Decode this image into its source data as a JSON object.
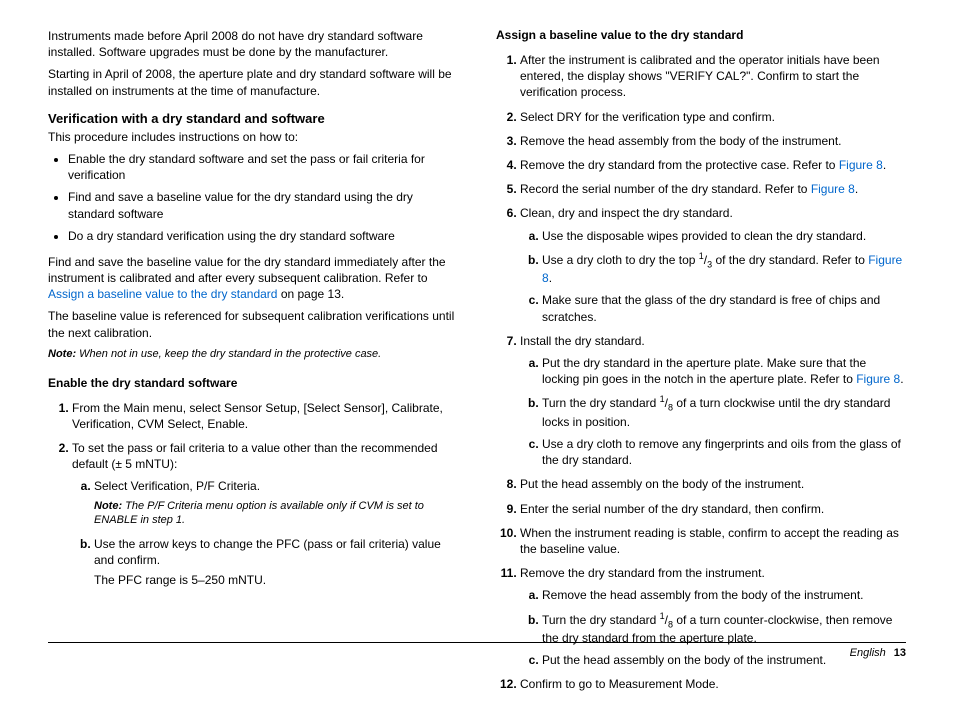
{
  "left": {
    "intro1": "Instruments made before April 2008 do not have dry standard software installed. Software upgrades must be done by the manufacturer.",
    "intro2": "Starting in April of 2008, the aperture plate and dry standard software will be installed on instruments at the time of manufacture.",
    "verif_heading": "Verification with a dry standard and software",
    "verif_intro": "This procedure includes instructions on how to:",
    "bullets": {
      "b1": "Enable the dry standard software and set the pass or fail criteria for verification",
      "b2": "Find and save a baseline value for the dry standard using the dry standard software",
      "b3": "Do a dry standard verification using the dry standard software"
    },
    "para_findsave_pre": "Find and save the baseline value for the dry standard immediately after the instrument is calibrated and after every subsequent calibration. Refer to ",
    "para_findsave_link": "Assign a baseline value to the dry standard",
    "para_findsave_post": " on page 13.",
    "para_baseline": "The baseline value is referenced for subsequent calibration verifications until the next calibration.",
    "note1_label": "Note:",
    "note1_text": " When not in use, keep the dry standard in the protective case.",
    "enable_heading": "Enable the dry standard software",
    "enable_steps": {
      "s1": "From the Main menu, select Sensor Setup, [Select Sensor], Calibrate, Verification, CVM Select, Enable.",
      "s2": "To set the pass or fail criteria to a value other than the recommended default (± 5 mNTU):",
      "s2a": "Select Verification, P/F Criteria.",
      "s2a_note_label": "Note:",
      "s2a_note_text": " The P/F Criteria menu option is available only if CVM is set to ENABLE in step 1.",
      "s2b": "Use the arrow keys to change the PFC (pass or fail criteria) value and confirm.",
      "s2b_extra": "The PFC range is 5–250 mNTU."
    }
  },
  "right": {
    "assign_heading": "Assign a baseline value to the dry standard",
    "s1": "After the instrument is calibrated and the operator initials have been entered, the display shows \"VERIFY CAL?\". Confirm to start the verification process.",
    "s2": "Select DRY for the verification type and confirm.",
    "s3": "Remove the head assembly from the body of the instrument.",
    "s4_pre": "Remove the dry standard from the protective case. Refer to ",
    "s4_link": "Figure 8",
    "s4_post": ".",
    "s5_pre": "Record the serial number of the dry standard. Refer to ",
    "s5_link": "Figure 8",
    "s5_post": ".",
    "s6": "Clean, dry and inspect the dry standard.",
    "s6a": "Use the disposable wipes provided to clean the dry standard.",
    "s6b_pre": "Use a dry cloth to dry the top ",
    "s6b_mid": " of the dry standard. Refer to ",
    "s6b_link": "Figure 8",
    "s6b_post": ".",
    "s6c": "Make sure that the glass of the dry standard is free of chips and scratches.",
    "s7": "Install the dry standard.",
    "s7a_pre": "Put the dry standard in the aperture plate. Make sure that the locking pin goes in the notch in the aperture plate. Refer to ",
    "s7a_link": "Figure 8",
    "s7a_post": ".",
    "s7b_pre": "Turn the dry standard ",
    "s7b_post": " of a turn clockwise until the dry standard locks in position.",
    "s7c": "Use a dry cloth to remove any fingerprints and oils from the glass of the dry standard.",
    "s8": "Put the head assembly on the body of the instrument.",
    "s9": "Enter the serial number of the dry standard, then confirm.",
    "s10": "When the instrument reading is stable, confirm to accept the reading as the baseline value.",
    "s11": "Remove the dry standard from the instrument.",
    "s11a": "Remove the head assembly from the body of the instrument.",
    "s11b_pre": "Turn the dry standard ",
    "s11b_post": " of a turn counter-clockwise, then remove the dry standard from the aperture plate.",
    "s11c": "Put the head assembly on the body of the instrument.",
    "s12": "Confirm to go to Measurement Mode."
  },
  "frac": {
    "one": "1",
    "three": "3",
    "eight": "8"
  },
  "footer": {
    "lang": "English",
    "page": "13"
  }
}
